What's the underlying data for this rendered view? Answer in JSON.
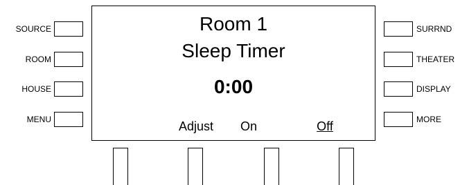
{
  "left_buttons": [
    {
      "label": "SOURCE"
    },
    {
      "label": "ROOM"
    },
    {
      "label": "HOUSE"
    },
    {
      "label": "MENU"
    }
  ],
  "right_buttons": [
    {
      "label": "SURRND"
    },
    {
      "label": "THEATER"
    },
    {
      "label": "DISPLAY"
    },
    {
      "label": "MORE"
    }
  ],
  "screen": {
    "room": "Room 1",
    "title": "Sleep Timer",
    "time": "0:00",
    "softkeys": [
      {
        "label": "Adjust"
      },
      {
        "label": "On"
      },
      {
        "label": "Off",
        "underlined": true
      },
      {
        "label": ""
      }
    ]
  }
}
